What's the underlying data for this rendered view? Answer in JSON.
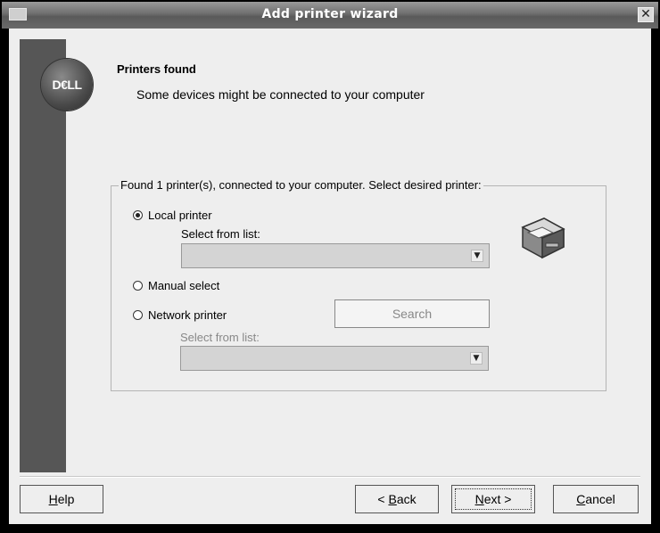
{
  "window": {
    "title": "Add printer wizard",
    "close_glyph": "✕"
  },
  "logo": {
    "text": "D€LL"
  },
  "header": {
    "title": "Printers found",
    "subtitle": "Some devices might be connected to your computer"
  },
  "group": {
    "legend": "Found 1 printer(s), connected to your computer. Select desired printer:",
    "local": {
      "label": "Local printer",
      "checked": true,
      "list_label": "Select from list:",
      "value": ""
    },
    "manual": {
      "label": "Manual select",
      "checked": false
    },
    "network": {
      "label": "Network printer",
      "checked": false,
      "list_label": "Select from list:",
      "value": "",
      "search_label": "Search"
    },
    "icon": "printer-icon"
  },
  "footer": {
    "help": {
      "mnemonic": "H",
      "rest": "elp"
    },
    "back": {
      "prefix": "< ",
      "mnemonic": "B",
      "rest": "ack"
    },
    "next": {
      "mnemonic": "N",
      "rest": "ext >"
    },
    "cancel": {
      "mnemonic": "C",
      "rest": "ancel"
    }
  }
}
